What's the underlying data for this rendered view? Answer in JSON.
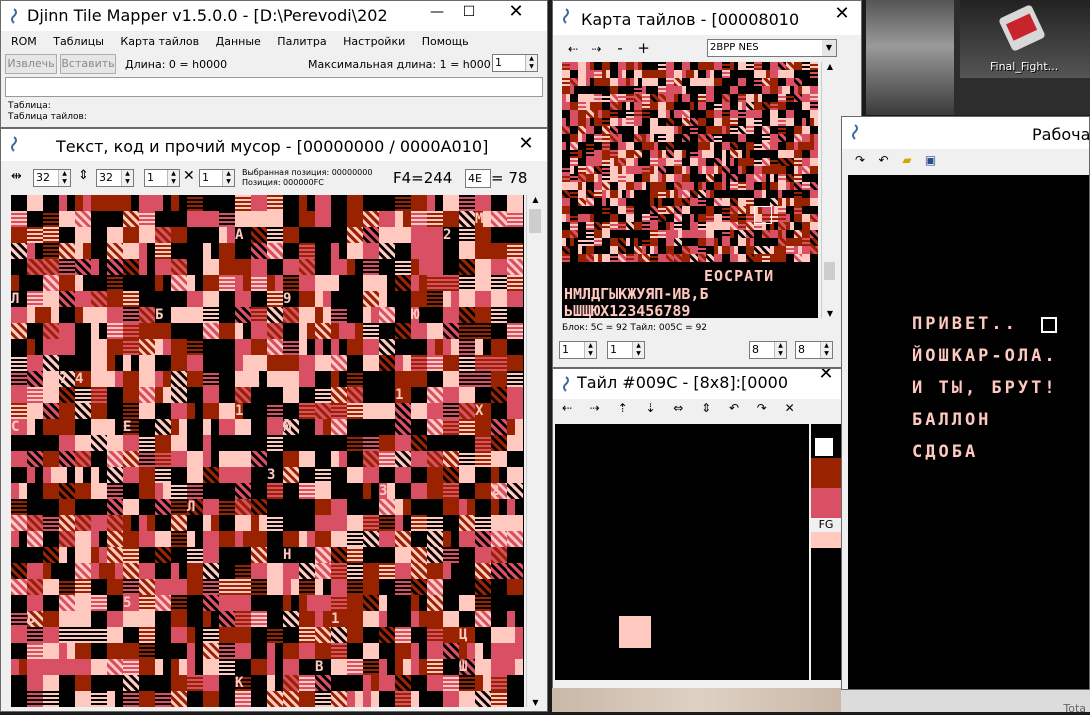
{
  "main": {
    "title": "Djinn Tile Mapper v1.5.0.0 - [D:\\Perevodi\\202",
    "menu": [
      "ROM",
      "Таблицы",
      "Карта тайлов",
      "Данные",
      "Палитра",
      "Настройки",
      "Помощь"
    ],
    "extract_btn": "Извлечь",
    "insert_btn": "Вставить",
    "length_label": "Длина: 0 = h0000",
    "maxlen_label": "Максимальная длина: 1 = h0001",
    "maxlen_value": "1",
    "table_label": "Таблица:",
    "tile_table_label": "Таблица тайлов:"
  },
  "text_window": {
    "title": "Текст, код и прочий мусор - [00000000 / 0000A010]",
    "width_value": "32",
    "height_value": "32",
    "v1": "1",
    "v2": "1",
    "selected_pos": "Выбранная позиция: 00000000",
    "position": "Позиция: 000000FC",
    "hex_info": "F4=244",
    "hex_input": "4E",
    "dec_value": "= 78"
  },
  "tilemap_window": {
    "title": "Карта тайлов - [00008010",
    "format": "2BPP NES",
    "minus": "-",
    "plus": "+",
    "block_info": "Блок: 5C = 92  Тайл: 005C = 92",
    "s1": "1",
    "s2": "1",
    "s3": "8",
    "s4": "8",
    "row1": "ЕОСРАТИ",
    "row2": "НМЛДГЫКЖУЯП-ИВ,Б",
    "row3": "ЬШЩЮХ123456789"
  },
  "tile_window": {
    "title": "Тайл #009C - [8x8]:[0000",
    "fg_label": "FG",
    "palette": [
      "#ffffff",
      "#992200",
      "#d94f63",
      "#ffc9c0"
    ]
  },
  "work_window": {
    "title": "Рабоча",
    "lines": [
      "ПРИВЕТ..",
      "ЙОШКАР-ОЛА.",
      "И ТЫ, БРУТ!",
      "БАЛЛОН",
      "СДОБА"
    ]
  },
  "desktop": {
    "icon_label": "Final_Fight...",
    "taskbar_text": "Tota"
  },
  "text_grid_glyphs": [
    "Л",
    "7",
    "Н",
    "М",
    "Ю",
    "2",
    "1",
    "3",
    "К",
    "Ш",
    "Л",
    "В",
    "1",
    "А",
    "5",
    "Б",
    "Ц",
    "М",
    "Н",
    "Ь",
    "Х",
    "Д",
    "Е",
    "1",
    "2",
    "9",
    "3",
    "4",
    "С",
    "Ж"
  ],
  "colors": {
    "accent": "#992200",
    "pink": "#d94f63",
    "light": "#ffc9c0",
    "black": "#000000"
  }
}
